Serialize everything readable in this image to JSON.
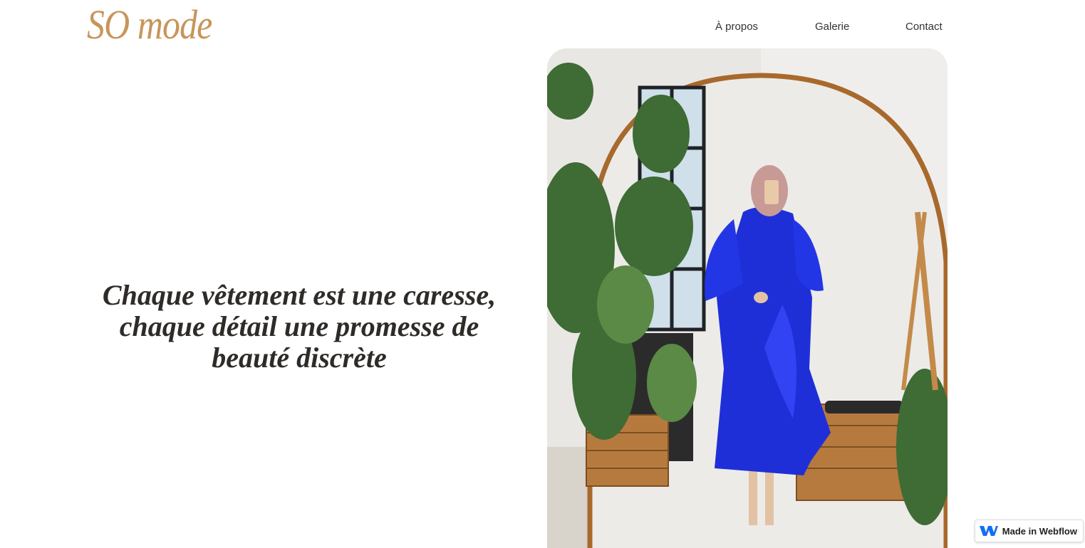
{
  "brand": {
    "logo_text": "SO mode",
    "logo_color": "#c8955a"
  },
  "nav": {
    "items": [
      {
        "label": "À propos"
      },
      {
        "label": "Galerie"
      },
      {
        "label": "Contact"
      }
    ]
  },
  "hero": {
    "tagline": "Chaque vêtement est une caresse, chaque détail une promesse de beauté discrète",
    "image_icon": "photo-woman-blue-dress-mirror",
    "dress_color": "#1f2fd8"
  },
  "badge": {
    "label": "Made in Webflow",
    "icon": "webflow-logo-icon",
    "icon_color": "#146ef5"
  }
}
